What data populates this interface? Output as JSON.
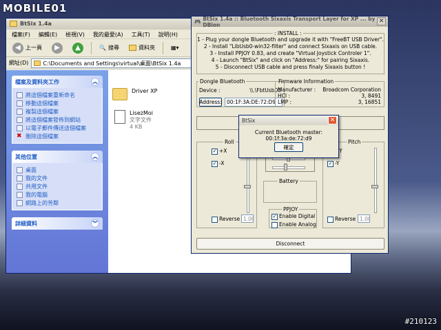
{
  "branding": {
    "logo": "MOBILE01",
    "watermark": "#210123"
  },
  "explorer": {
    "title": "BtSix 1.4a",
    "menu": [
      "檔案(F)",
      "編輯(E)",
      "檢視(V)",
      "我的最愛(A)",
      "工具(T)",
      "說明(H)"
    ],
    "toolbar": {
      "back": "上一頁",
      "search": "搜尋",
      "folders": "資料夾"
    },
    "address_label": "網址(D)",
    "address": "C:\\Documents and Settings\\virtual\\桌面\\BtSix 1.4a",
    "tasks_title": "檔案及資料夾工作",
    "tasks": [
      "將這個檔案重新命名",
      "移動這個檔案",
      "複製這個檔案",
      "將這個檔案發佈到網站",
      "以電子郵件傳送這個檔案",
      "刪除這個檔案"
    ],
    "places_title": "其他位置",
    "places": [
      "桌面",
      "我的文件",
      "共用文件",
      "我的電腦",
      "網路上的芳鄰"
    ],
    "details_title": "詳細資料",
    "files": [
      {
        "name": "Driver XP",
        "sub1": "",
        "sub2": ""
      },
      {
        "name": "LisezMoi",
        "sub1": "文字文件",
        "sub2": "4 KB"
      }
    ]
  },
  "btsix": {
    "title": "BtSix 1.4a :: Bluetooth Sixaxis Transport Layer for XP ... by DBion",
    "install_legend": ": INSTALL :",
    "install_lines": [
      "1 - Plug your dongle Bluetooth and upgrade it with \"FreeBT USB Driver\".",
      "2 - Install \"LibUsb0-win32-filter\" and connect Sixaxis on USB cable.",
      "3 - Install PPJOY 0.83, and create \"Virtual Joystick Controler 1\".",
      "4 - Launch \"BtSix\" and click on \"Address:\" for pairing Sixaxis.",
      "5 - Disconnect USB cable and press finaly Sixaxis button !"
    ],
    "dongle": {
      "legend": "Dongle Bluetooth",
      "device_label": "Device :",
      "device": "\\\\.\\FbtUsb00",
      "address_button": "Address:",
      "address": "00:1F:3A:DE:72:D9"
    },
    "firmware": {
      "legend": "Firmware Information",
      "manufacturer_label": "Manufacturer :",
      "manufacturer": "Broadcom Corporation",
      "hci_label": "HCI :",
      "hci": "3, 8491",
      "lmp_label": "LMP :",
      "lmp": "3, 16851"
    },
    "roll": {
      "legend": "Roll",
      "plus": "+X",
      "minus": "-X",
      "reverse": "Reverse",
      "value": "1.00"
    },
    "pitch": {
      "legend": "Pitch",
      "plus": "+Y",
      "minus": "-Y",
      "reverse": "Reverse",
      "value": "1.00"
    },
    "battery_legend": "Battery",
    "ppjoy": {
      "legend": "PPJOY",
      "digital": "Enable Digital",
      "analog": "Enable Analog",
      "digital_checked": true,
      "analog_checked": false
    },
    "disconnect": "Disconnect"
  },
  "dialog": {
    "title": "BtSix",
    "message": "Current Bluetooth master: 00:1f:3a:de:72:d9",
    "ok": "確定"
  }
}
